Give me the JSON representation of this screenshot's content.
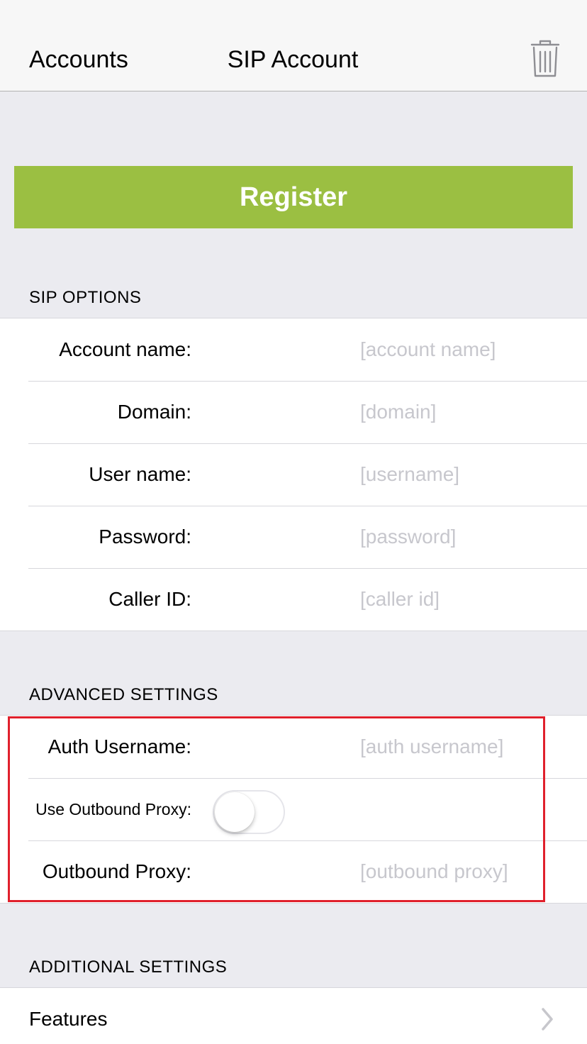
{
  "nav": {
    "back_label": "Accounts",
    "title": "SIP Account",
    "trash_icon": "trash-icon"
  },
  "register": {
    "label": "Register",
    "color": "#9bbf42"
  },
  "sip_options": {
    "header": "SIP OPTIONS",
    "rows": [
      {
        "label": "Account name:",
        "placeholder": "[account name]",
        "value": ""
      },
      {
        "label": "Domain:",
        "placeholder": "[domain]",
        "value": ""
      },
      {
        "label": "User name:",
        "placeholder": "[username]",
        "value": ""
      },
      {
        "label": "Password:",
        "placeholder": "[password]",
        "value": ""
      },
      {
        "label": "Caller ID:",
        "placeholder": "[caller id]",
        "value": ""
      }
    ]
  },
  "advanced": {
    "header": "ADVANCED SETTINGS",
    "auth_username": {
      "label": "Auth Username:",
      "placeholder": "[auth username]",
      "value": ""
    },
    "use_outbound_proxy": {
      "label": "Use Outbound Proxy:",
      "on": false
    },
    "outbound_proxy": {
      "label": "Outbound Proxy:",
      "placeholder": "[outbound proxy]",
      "value": ""
    },
    "highlight_color": "#e0202c"
  },
  "additional": {
    "header": "ADDITIONAL SETTINGS",
    "features_label": "Features",
    "chevron_icon": "chevron-right-icon"
  }
}
